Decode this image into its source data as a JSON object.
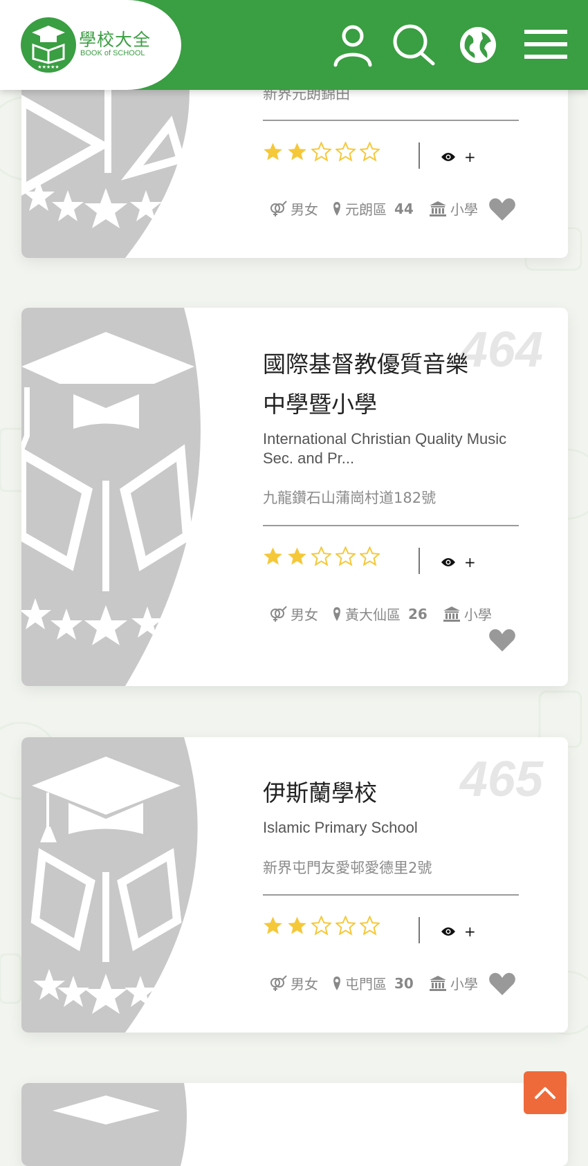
{
  "header": {
    "logo_cn": "學校大全",
    "logo_en": "BOOK of SCHOOL",
    "icons": [
      "user-icon",
      "search-icon",
      "globe-icon",
      "menu-icon"
    ],
    "brand_color": "#3a9e42"
  },
  "cards": [
    {
      "address": "新界元朗錦田",
      "rating": 2,
      "rating_max": 5,
      "views": "+",
      "gender": "男女",
      "district": "元朗區",
      "district_count": "44",
      "level": "小學"
    },
    {
      "number": "464",
      "name_cn": "國際基督教優質音樂中學暨小學",
      "name_en": "International Christian Quality Music Sec. and Pr...",
      "address": "九龍鑽石山蒲崗村道182號",
      "rating": 2,
      "rating_max": 5,
      "views": "+",
      "gender": "男女",
      "district": "黃大仙區",
      "district_count": "26",
      "level": "小學"
    },
    {
      "number": "465",
      "name_cn": "伊斯蘭學校",
      "name_en": "Islamic Primary School",
      "address": "新界屯門友愛邨愛德里2號",
      "rating": 2,
      "rating_max": 5,
      "views": "+",
      "gender": "男女",
      "district": "屯門區",
      "district_count": "30",
      "level": "小學"
    }
  ],
  "colors": {
    "star": "#f5c83a",
    "placeholder": "#c8c8c8",
    "back_to_top": "#ef6a3a"
  }
}
